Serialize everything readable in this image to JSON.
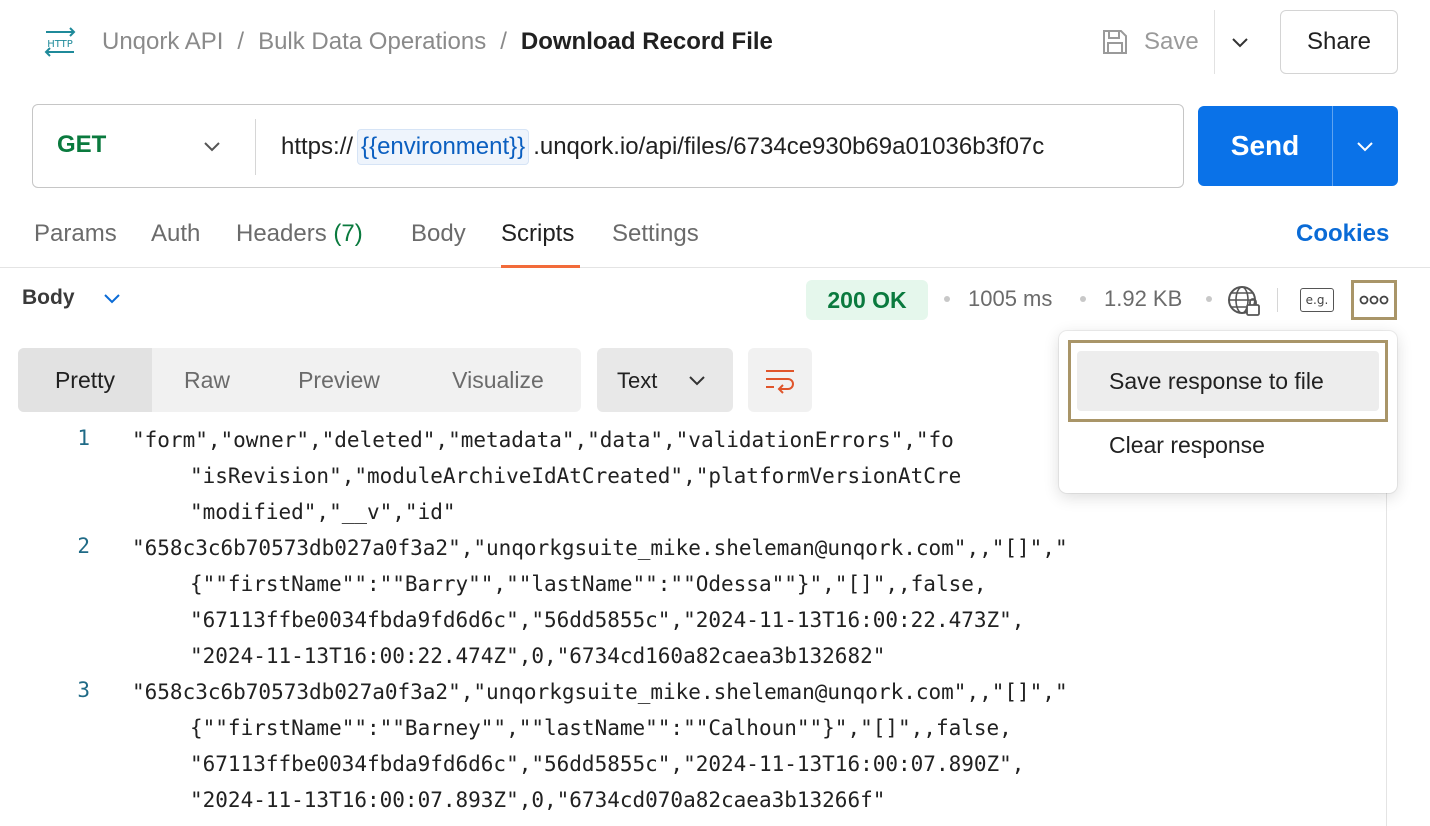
{
  "header": {
    "icon": "http-icon",
    "breadcrumb": [
      "Unqork API",
      "Bulk Data Operations"
    ],
    "separator": "/",
    "current": "Download Record File",
    "save_label": "Save",
    "share_label": "Share"
  },
  "request": {
    "method": "GET",
    "url_prefix": "https://",
    "url_variable": "{{environment}}",
    "url_suffix": ".unqork.io/api/files/6734ce930b69a01036b3f07c",
    "send_label": "Send"
  },
  "tabs": {
    "params": "Params",
    "auth": "Auth",
    "headers": "Headers",
    "headers_count": "(7)",
    "body": "Body",
    "scripts": "Scripts",
    "settings": "Settings",
    "active": "Scripts",
    "cookies": "Cookies"
  },
  "response": {
    "section_label": "Body",
    "status": "200 OK",
    "time": "1005 ms",
    "size": "1.92 KB",
    "example_label": "e.g.",
    "views": [
      "Pretty",
      "Raw",
      "Preview",
      "Visualize"
    ],
    "active_view": "Pretty",
    "format": "Text"
  },
  "menu": {
    "items": [
      "Save response to file",
      "Clear response"
    ],
    "highlighted": "Save response to file"
  },
  "code": {
    "lines": [
      {
        "n": "1",
        "parts": [
          "\"form\",\"owner\",\"deleted\",\"metadata\",\"data\",\"validationErrors\",\"fo",
          "\"isRevision\",\"moduleArchiveIdAtCreated\",\"platformVersionAtCre",
          "\"modified\",\"__v\",\"id\""
        ]
      },
      {
        "n": "2",
        "parts": [
          "\"658c3c6b70573db027a0f3a2\",\"unqorkgsuite_mike.sheleman@unqork.com\",,\"[]\",\"",
          "{\"\"firstName\"\":\"\"Barry\"\",\"\"lastName\"\":\"\"Odessa\"\"}\",\"[]\",,false,",
          "\"67113ffbe0034fbda9fd6d6c\",\"56dd5855c\",\"2024-11-13T16:00:22.473Z\",",
          "\"2024-11-13T16:00:22.474Z\",0,\"6734cd160a82caea3b132682\""
        ]
      },
      {
        "n": "3",
        "parts": [
          "\"658c3c6b70573db027a0f3a2\",\"unqorkgsuite_mike.sheleman@unqork.com\",,\"[]\",\"",
          "{\"\"firstName\"\":\"\"Barney\"\",\"\"lastName\"\":\"\"Calhoun\"\"}\",\"[]\",,false,",
          "\"67113ffbe0034fbda9fd6d6c\",\"56dd5855c\",\"2024-11-13T16:00:07.890Z\",",
          "\"2024-11-13T16:00:07.893Z\",0,\"6734cd070a82caea3b13266f\""
        ]
      }
    ]
  },
  "colors": {
    "accent": "#0a72e8",
    "method": "#0a7a3e",
    "status_bg": "#e5f7ec",
    "active_tab_underline": "#f26b3a",
    "highlight_frame": "#a99568"
  }
}
